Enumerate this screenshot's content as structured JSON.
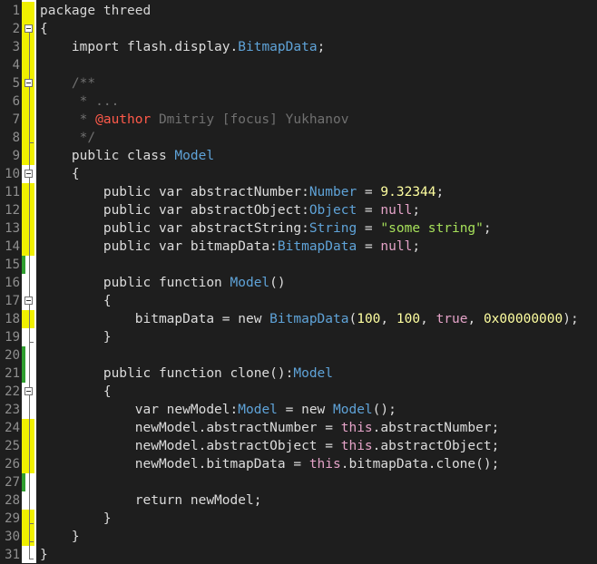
{
  "line_numbers": [
    "1",
    "2",
    "3",
    "4",
    "5",
    "6",
    "7",
    "8",
    "9",
    "10",
    "11",
    "12",
    "13",
    "14",
    "15",
    "16",
    "17",
    "18",
    "19",
    "20",
    "21",
    "22",
    "23",
    "24",
    "25",
    "26",
    "27",
    "28",
    "29",
    "30",
    "31"
  ],
  "code": {
    "l1": [
      "package threed"
    ],
    "l2": [
      "{"
    ],
    "l3": [
      "    import flash.display.",
      "BitmapData",
      ";"
    ],
    "l5": [
      "    /**"
    ],
    "l6": [
      "     * ..."
    ],
    "l7": [
      "     * ",
      "@author",
      " Dmitriy [focus] Yukhanov"
    ],
    "l8": [
      "     */"
    ],
    "l9": [
      "    public class ",
      "Model"
    ],
    "l10": [
      "    {"
    ],
    "l11": [
      "        public var abstractNumber:",
      "Number",
      " = ",
      "9.32344",
      ";"
    ],
    "l12": [
      "        public var abstractObject:",
      "Object",
      " = ",
      "null",
      ";"
    ],
    "l13": [
      "        public var abstractString:",
      "String",
      " = ",
      "\"some string\"",
      ";"
    ],
    "l14": [
      "        public var bitmapData:",
      "BitmapData",
      " = ",
      "null",
      ";"
    ],
    "l16": [
      "        public function ",
      "Model",
      "()"
    ],
    "l17": [
      "        {"
    ],
    "l18": [
      "            bitmapData = new ",
      "BitmapData",
      "(",
      "100",
      ", ",
      "100",
      ", ",
      "true",
      ", ",
      "0x00000000",
      ");"
    ],
    "l19": [
      "        }"
    ],
    "l21": [
      "        public function clone():",
      "Model"
    ],
    "l22": [
      "        {"
    ],
    "l23": [
      "            var newModel:",
      "Model",
      " = new ",
      "Model",
      "();"
    ],
    "l24": [
      "            newModel.abstractNumber = ",
      "this",
      ".abstractNumber;"
    ],
    "l25": [
      "            newModel.abstractObject = ",
      "this",
      ".abstractObject;"
    ],
    "l26": [
      "            newModel.bitmapData = ",
      "this",
      ".bitmapData.clone();"
    ],
    "l28": [
      "            return newModel;"
    ],
    "l29": [
      "        }"
    ],
    "l30": [
      "    }"
    ],
    "l31": [
      "}"
    ]
  },
  "colors": {
    "background": "#1e1e1e",
    "gutter_change_marker": "#f0f000",
    "gutter_saved_marker": "#2f9e2f",
    "type": "#5fa3d8",
    "number": "#ffffa0",
    "string": "#a6e05a",
    "keyword_constant": "#e5a3c8",
    "comment": "#707070",
    "doc_tag": "#ff5a4a"
  }
}
